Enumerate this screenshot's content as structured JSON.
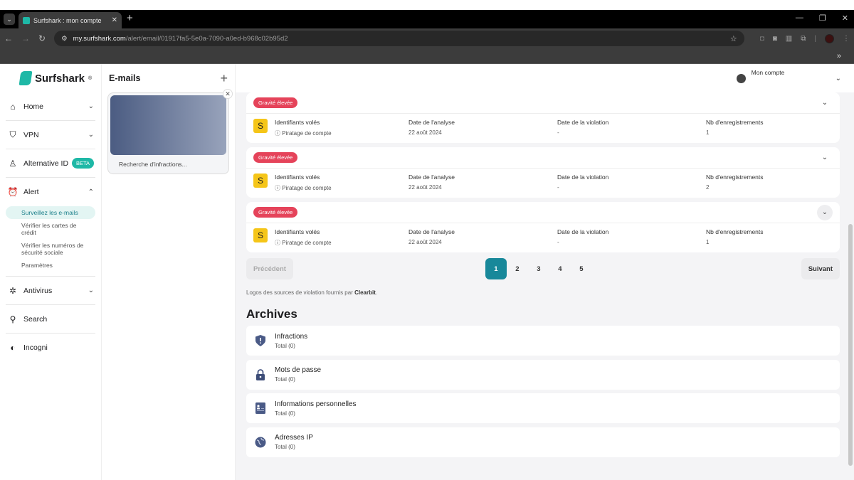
{
  "browser": {
    "tab_title": "Surfshark : mon compte",
    "url_host": "my.surfshark.com",
    "url_path": "/alert/email/01917fa5-5e0a-7090-a0ed-b968c02b95d2",
    "bookmarks_more": "»"
  },
  "sidebar": {
    "brand": "Surfshark",
    "items": [
      {
        "label": "Home",
        "icon": "home-icon"
      },
      {
        "label": "VPN",
        "icon": "shield-icon"
      },
      {
        "label": "Alternative ID",
        "icon": "user-icon",
        "badge": "BETA"
      },
      {
        "label": "Alert",
        "icon": "alarm-icon"
      },
      {
        "label": "Antivirus",
        "icon": "bug-icon"
      },
      {
        "label": "Search",
        "icon": "search-icon"
      },
      {
        "label": "Incogni",
        "icon": "toggle-icon"
      }
    ],
    "alert_sub": [
      "Surveillez les e-mails",
      "Vérifier les cartes de crédit",
      "Vérifier les numéros de sécurité sociale",
      "Paramètres"
    ]
  },
  "emails": {
    "title": "E-mails",
    "card_status": "Recherche d'infractions..."
  },
  "account": {
    "label": "Mon compte"
  },
  "breaches": [
    {
      "severity": "Gravité élevée",
      "source_letter": "S",
      "type": "Identifiants volés",
      "category": "Piratage de compte",
      "h_scan": "Date de l'analyse",
      "scan_date": "22 août 2024",
      "h_violation": "Date de la violation",
      "violation_date": "-",
      "h_records": "Nb d'enregistrements",
      "records": "1"
    },
    {
      "severity": "Gravité élevée",
      "source_letter": "S",
      "type": "Identifiants volés",
      "category": "Piratage de compte",
      "h_scan": "Date de l'analyse",
      "scan_date": "22 août 2024",
      "h_violation": "Date de la violation",
      "violation_date": "-",
      "h_records": "Nb d'enregistrements",
      "records": "2"
    },
    {
      "severity": "Gravité élevée",
      "source_letter": "S",
      "type": "Identifiants volés",
      "category": "Piratage de compte",
      "h_scan": "Date de l'analyse",
      "scan_date": "22 août 2024",
      "h_violation": "Date de la violation",
      "violation_date": "-",
      "h_records": "Nb d'enregistrements",
      "records": "1"
    }
  ],
  "pagination": {
    "prev": "Précédent",
    "next": "Suivant",
    "pages": [
      "1",
      "2",
      "3",
      "4",
      "5"
    ],
    "current": "1"
  },
  "credit": {
    "text": "Logos des sources de violation fournis par ",
    "brand": "Clearbit",
    "end": "."
  },
  "archives": {
    "title": "Archives",
    "items": [
      {
        "label": "Infractions",
        "total": "Total (0)"
      },
      {
        "label": "Mots de passe",
        "total": "Total (0)"
      },
      {
        "label": "Informations personnelles",
        "total": "Total (0)"
      },
      {
        "label": "Adresses IP",
        "total": "Total (0)"
      }
    ]
  }
}
